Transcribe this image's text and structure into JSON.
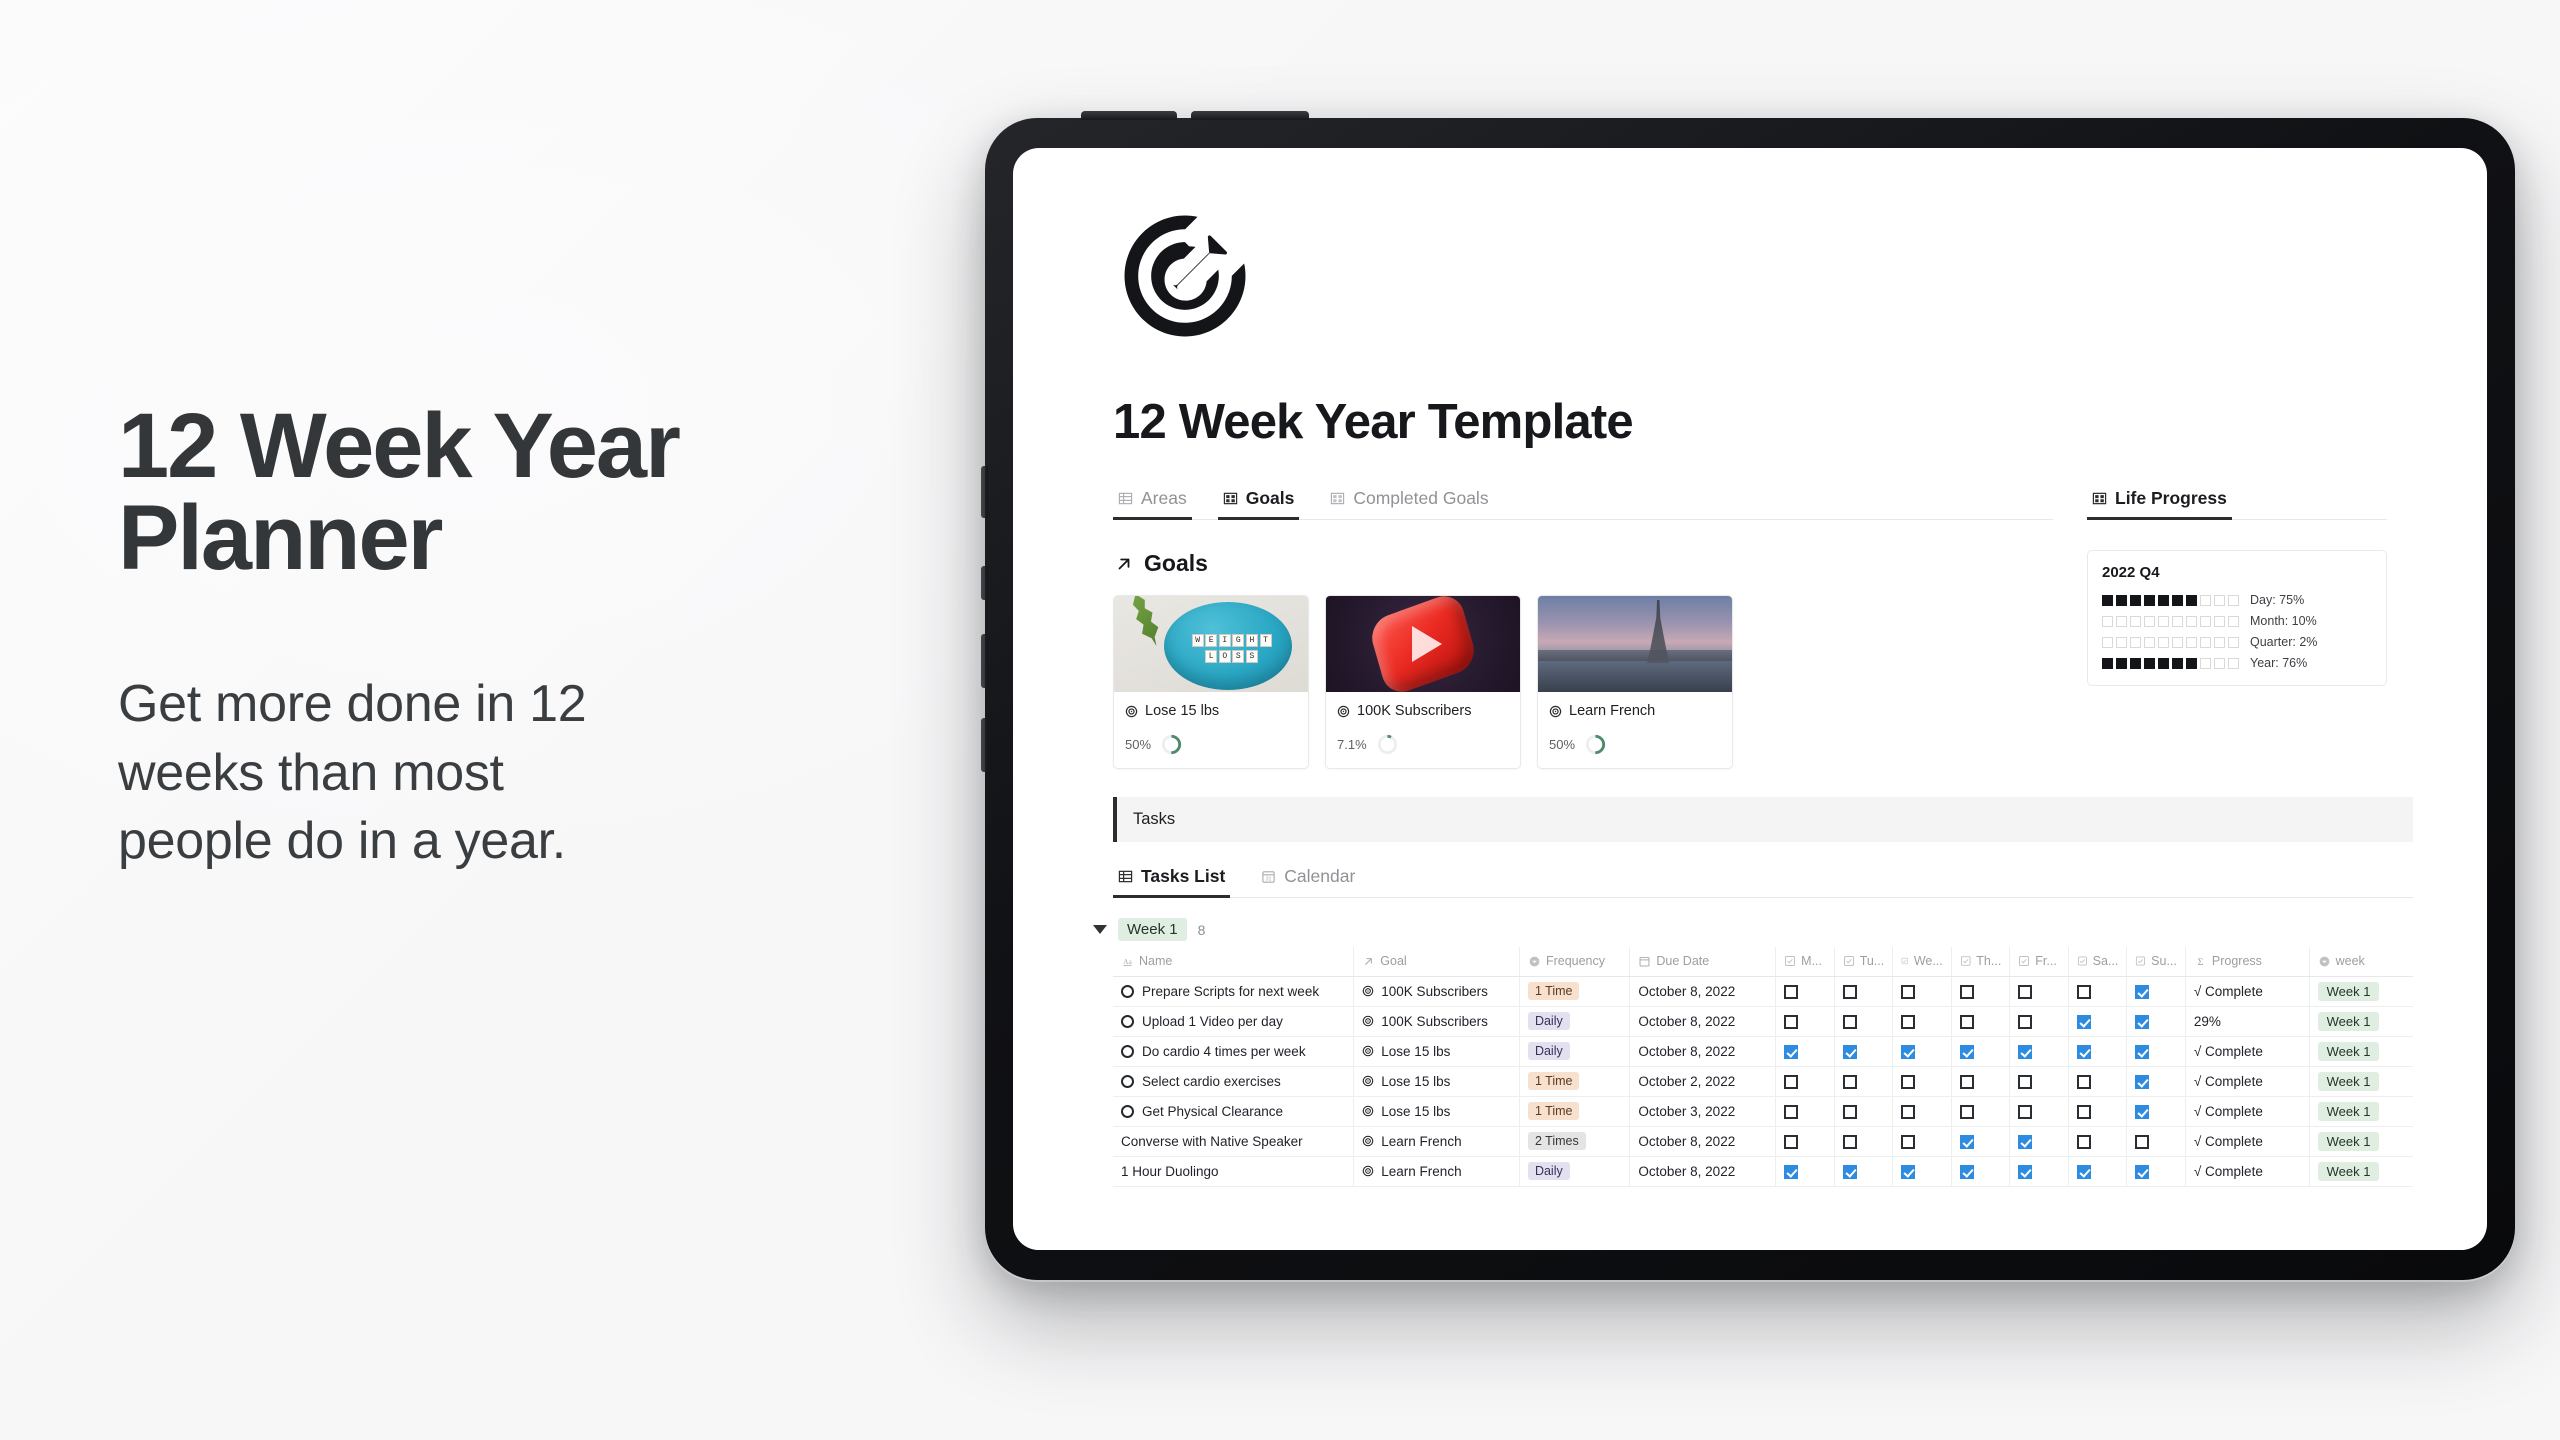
{
  "marketing": {
    "headline": "12 Week Year\nPlanner",
    "subhead": "Get more done in 12\nweeks than most\npeople do in a year."
  },
  "app": {
    "doc_title": "12 Week Year Template",
    "logo_icon": "target-arrow-icon"
  },
  "view_tabs": [
    {
      "label": "Areas",
      "icon": "table-icon",
      "active": false
    },
    {
      "label": "Goals",
      "icon": "gallery-icon",
      "active": true
    },
    {
      "label": "Completed Goals",
      "icon": "gallery-icon",
      "active": false
    }
  ],
  "goals_section": {
    "heading": "Goals",
    "heading_icon": "arrow-up-right-icon",
    "cards": [
      {
        "title": "Lose 15 lbs",
        "icon": "target-icon",
        "progress_label": "50%",
        "progress_value": 50,
        "art": "weight-loss-plate",
        "art_text": [
          "WEIGHT",
          "LOSS"
        ]
      },
      {
        "title": "100K Subscribers",
        "icon": "target-icon",
        "progress_label": "7.1%",
        "progress_value": 7.1,
        "art": "youtube-play-button",
        "art_text": []
      },
      {
        "title": "Learn French",
        "icon": "target-icon",
        "progress_label": "50%",
        "progress_value": 50,
        "art": "eiffel-tower-paris",
        "art_text": []
      }
    ]
  },
  "life_progress": {
    "tab_label": "Life Progress",
    "tab_icon": "gallery-icon",
    "period": "2022 Q4",
    "cells_total": 10,
    "rows": [
      {
        "label": "Day: 75%",
        "filled": 7
      },
      {
        "label": "Month: 10%",
        "filled": 0
      },
      {
        "label": "Quarter: 2%",
        "filled": 0
      },
      {
        "label": "Year: 76%",
        "filled": 7
      }
    ]
  },
  "tasks_callout": "Tasks",
  "task_tabs": [
    {
      "label": "Tasks List",
      "icon": "table-icon",
      "active": true
    },
    {
      "label": "Calendar",
      "icon": "calendar-icon",
      "active": false
    }
  ],
  "group": {
    "label": "Week 1",
    "count": "8"
  },
  "table": {
    "columns": [
      {
        "key": "name",
        "label": "Name",
        "icon": "text-aa-icon",
        "cls": "c-name"
      },
      {
        "key": "goal",
        "label": "Goal",
        "icon": "arrow-up-right-icon",
        "cls": "c-goal"
      },
      {
        "key": "freq",
        "label": "Frequency",
        "icon": "select-icon",
        "cls": "c-freq"
      },
      {
        "key": "due",
        "label": "Due Date",
        "icon": "calendar-icon",
        "cls": "c-due"
      },
      {
        "key": "mon",
        "label": "M...",
        "icon": "checkbox-icon",
        "cls": "c-day"
      },
      {
        "key": "tue",
        "label": "Tu...",
        "icon": "checkbox-icon",
        "cls": "c-day"
      },
      {
        "key": "wed",
        "label": "We...",
        "icon": "checkbox-icon",
        "cls": "c-day"
      },
      {
        "key": "thu",
        "label": "Th...",
        "icon": "checkbox-icon",
        "cls": "c-day"
      },
      {
        "key": "fri",
        "label": "Fr...",
        "icon": "checkbox-icon",
        "cls": "c-day"
      },
      {
        "key": "sat",
        "label": "Sa...",
        "icon": "checkbox-icon",
        "cls": "c-day"
      },
      {
        "key": "sun",
        "label": "Su...",
        "icon": "checkbox-icon",
        "cls": "c-day"
      },
      {
        "key": "progress",
        "label": "Progress",
        "icon": "sigma-icon",
        "cls": "c-prog"
      },
      {
        "key": "week",
        "label": "week",
        "icon": "select-icon",
        "cls": "c-week"
      }
    ],
    "rows": [
      {
        "name": "Prepare Scripts for next week",
        "has_circle": true,
        "goal": "100K Subscribers",
        "freq": "1 Time",
        "freq_style": "tag-time",
        "due": "October 8, 2022",
        "days": [
          false,
          false,
          false,
          false,
          false,
          false,
          true
        ],
        "progress": "√ Complete",
        "week": "Week 1"
      },
      {
        "name": "Upload 1 Video per day",
        "has_circle": true,
        "goal": "100K Subscribers",
        "freq": "Daily",
        "freq_style": "tag-daily",
        "due": "October 8, 2022",
        "days": [
          false,
          false,
          false,
          false,
          false,
          true,
          true
        ],
        "progress": "29%",
        "week": "Week 1"
      },
      {
        "name": "Do cardio 4 times per week",
        "has_circle": true,
        "goal": "Lose 15 lbs",
        "freq": "Daily",
        "freq_style": "tag-daily",
        "due": "October 8, 2022",
        "days": [
          true,
          true,
          true,
          true,
          true,
          true,
          true
        ],
        "progress": "√ Complete",
        "week": "Week 1"
      },
      {
        "name": "Select cardio exercises",
        "has_circle": true,
        "goal": "Lose 15 lbs",
        "freq": "1 Time",
        "freq_style": "tag-time",
        "due": "October 2, 2022",
        "days": [
          false,
          false,
          false,
          false,
          false,
          false,
          true
        ],
        "progress": "√ Complete",
        "week": "Week 1"
      },
      {
        "name": "Get Physical Clearance",
        "has_circle": true,
        "goal": "Lose 15 lbs",
        "freq": "1 Time",
        "freq_style": "tag-time",
        "due": "October 3, 2022",
        "days": [
          false,
          false,
          false,
          false,
          false,
          false,
          true
        ],
        "progress": "√ Complete",
        "week": "Week 1"
      },
      {
        "name": "Converse with Native Speaker",
        "has_circle": false,
        "goal": "Learn French",
        "freq": "2 Times",
        "freq_style": "tag-gray",
        "due": "October 8, 2022",
        "days": [
          false,
          false,
          false,
          true,
          true,
          false,
          false
        ],
        "progress": "√ Complete",
        "week": "Week 1"
      },
      {
        "name": "1 Hour Duolingo",
        "has_circle": false,
        "goal": "Learn French",
        "freq": "Daily",
        "freq_style": "tag-daily",
        "due": "October 8, 2022",
        "days": [
          true,
          true,
          true,
          true,
          true,
          true,
          true
        ],
        "progress": "√ Complete",
        "week": "Week 1"
      }
    ]
  },
  "colors": {
    "accent_green": "#4f8a6a",
    "checkbox_blue": "#2d8ce0",
    "pill_green_bg": "#dfeee0",
    "tag_time_bg": "#f7e0cd",
    "tag_daily_bg": "#e3e0ef",
    "page_bg": "#f7f7f8",
    "text_dark": "#16181c"
  }
}
